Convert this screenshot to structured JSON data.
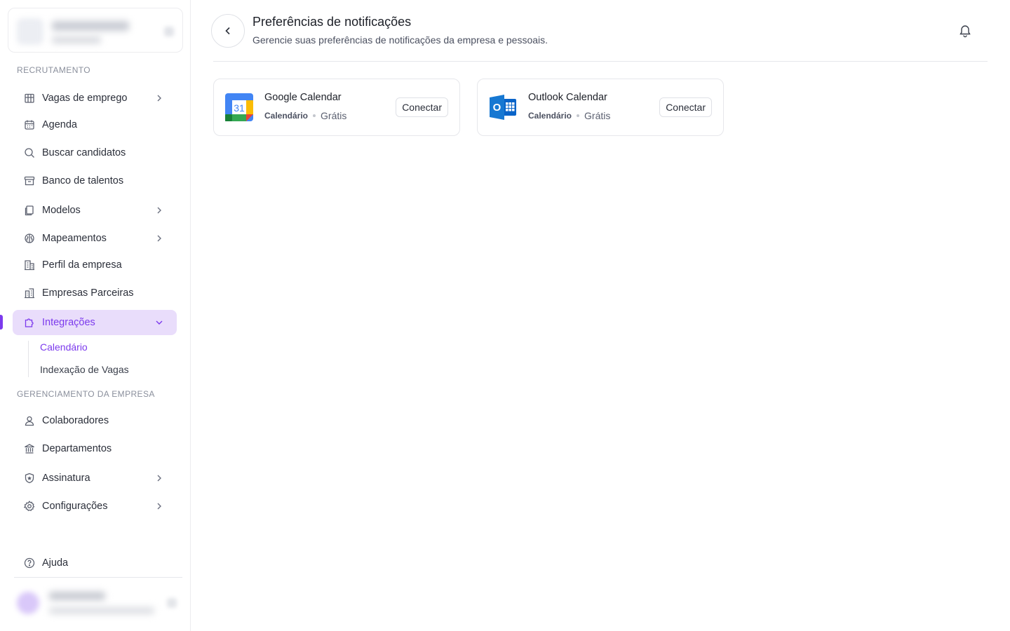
{
  "sidebar": {
    "section_recruitment": "RECRUTAMENTO",
    "section_management": "GERENCIAMENTO DA EMPRESA",
    "items": [
      {
        "label": "Vagas de emprego"
      },
      {
        "label": "Agenda"
      },
      {
        "label": "Buscar candidatos"
      },
      {
        "label": "Banco de talentos"
      },
      {
        "label": "Modelos"
      },
      {
        "label": "Mapeamentos"
      },
      {
        "label": "Perfil da empresa"
      },
      {
        "label": "Empresas Parceiras"
      },
      {
        "label": "Integrações"
      }
    ],
    "subitems": [
      {
        "label": "Calendário"
      },
      {
        "label": "Indexação de Vagas"
      }
    ],
    "management_items": [
      {
        "label": "Colaboradores"
      },
      {
        "label": "Departamentos"
      },
      {
        "label": "Assinatura"
      },
      {
        "label": "Configurações"
      }
    ],
    "help_label": "Ajuda"
  },
  "header": {
    "title": "Preferências de notificações",
    "subtitle": "Gerencie suas preferências de notificações da empresa e pessoais."
  },
  "integrations": [
    {
      "name": "Google Calendar",
      "category": "Calendário",
      "price": "Grátis",
      "button": "Conectar",
      "icon": "google-calendar-icon",
      "calendar_day": "31"
    },
    {
      "name": "Outlook Calendar",
      "category": "Calendário",
      "price": "Grátis",
      "button": "Conectar",
      "icon": "outlook-icon",
      "letter": "O"
    }
  ],
  "colors": {
    "accent": "#7c3aed",
    "active_bg": "#e9ddfb"
  }
}
